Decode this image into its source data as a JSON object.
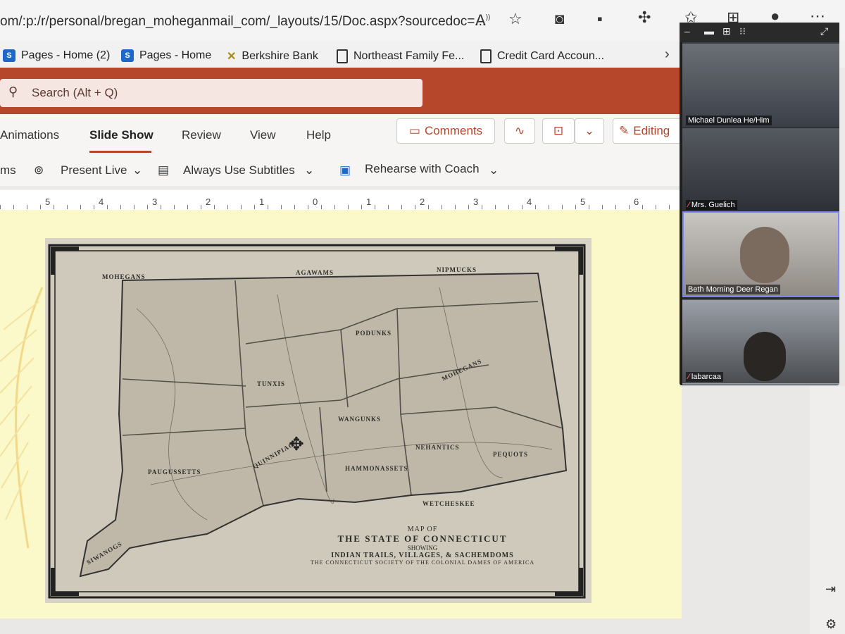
{
  "browser": {
    "url": "om/:p:/r/personal/bregan_moheganmail_com/_layouts/15/Doc.aspx?sourcedoc=...",
    "favorites": [
      {
        "label": "Pages - Home (2)",
        "icon": "sharepoint-icon"
      },
      {
        "label": "Pages - Home",
        "icon": "sharepoint-icon"
      },
      {
        "label": "Berkshire Bank",
        "icon": "berkshire-bank-icon"
      },
      {
        "label": "Northeast Family Fe...",
        "icon": "document-icon"
      },
      {
        "label": "Credit Card Accoun...",
        "icon": "document-icon"
      }
    ]
  },
  "office": {
    "search_label": "Search (Alt + Q)",
    "tabs": [
      "Animations",
      "Slide Show",
      "Review",
      "View",
      "Help"
    ],
    "active_tab": "Slide Show",
    "comments_label": "Comments",
    "editing_label": "Editing",
    "commands": {
      "partial": "ms",
      "present_live": "Present Live",
      "subtitles": "Always Use Subtitles",
      "rehearse": "Rehearse with Coach"
    },
    "ruler_labels": [
      "5",
      "4",
      "3",
      "2",
      "1",
      "0",
      "1",
      "2",
      "3",
      "4",
      "5",
      "6"
    ]
  },
  "map": {
    "title_lines": [
      "MAP OF",
      "THE STATE OF CONNECTICUT",
      "SHOWING",
      "INDIAN TRAILS, VILLAGES, & SACHEMDOMS",
      "THE CONNECTICUT SOCIETY OF THE COLONIAL DAMES OF AMERICA"
    ],
    "labels": [
      "MOHEGANS",
      "NIPMUCKS",
      "AGAWAMS",
      "PODUNKS",
      "MOHEGANS",
      "TUNXIS",
      "WANGUNKS",
      "PAUGUSSETTS",
      "QUINNIPIACS",
      "HAMMONASSETS",
      "PEQUOTS",
      "NEHANTICS",
      "SIWANOGS",
      "WETCHESKEE"
    ]
  },
  "teams": {
    "participants": [
      {
        "name": "Michael Dunlea He/Him",
        "muted": false,
        "active": false
      },
      {
        "name": "Mrs. Guelich",
        "muted": true,
        "active": false
      },
      {
        "name": "Beth Morning Deer Regan",
        "muted": false,
        "active": true
      },
      {
        "name": "labarcaa",
        "muted": true,
        "active": false
      }
    ]
  },
  "colors": {
    "office_accent": "#b7472a",
    "slide_background": "#fbf8c9",
    "teams_active_border": "#7f85f5"
  }
}
